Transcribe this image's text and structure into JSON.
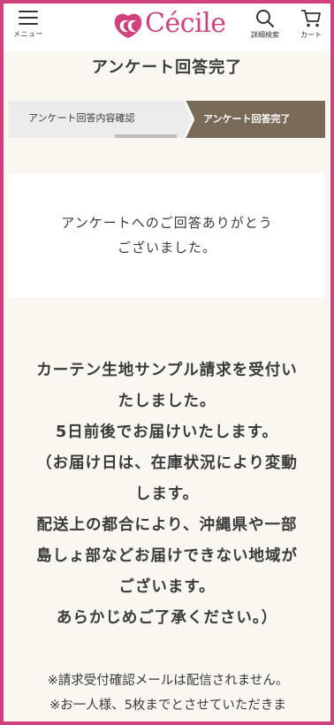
{
  "header": {
    "menu_label": "メニュー",
    "logo_text": "Cécile",
    "search_label": "詳細検索",
    "cart_label": "カート"
  },
  "page": {
    "title": "アンケート回答完了"
  },
  "steps": {
    "items": [
      {
        "label": "アンケート回答内容確認",
        "active": false
      },
      {
        "label": "アンケート回答完了",
        "active": true
      }
    ]
  },
  "thanks": {
    "lines": [
      "アンケートへのご回答ありがとう",
      "ございました。"
    ]
  },
  "message": {
    "lines": [
      "カーテン生地サンプル請求を受付い",
      "たしました。",
      "5日前後でお届けいたします。",
      "（お届け日は、在庫状況により変動",
      "します。",
      "配送上の都合により、沖縄県や一部",
      "島しょ部などお届けできない地域が",
      "ございます。",
      "あらかじめご了承ください。）"
    ]
  },
  "notes": {
    "lines": [
      "※請求受付確認メールは配信されません。",
      "※お一人様、5枚までとさせていただきま"
    ]
  },
  "colors": {
    "brand": "#d0427e",
    "step_active": "#7a6a58",
    "step_inactive": "#ececec",
    "background": "#faf7f0"
  },
  "icons": {
    "menu": "hamburger-icon",
    "search": "search-icon",
    "cart": "cart-icon",
    "logo": "cecile-logo-mark"
  }
}
